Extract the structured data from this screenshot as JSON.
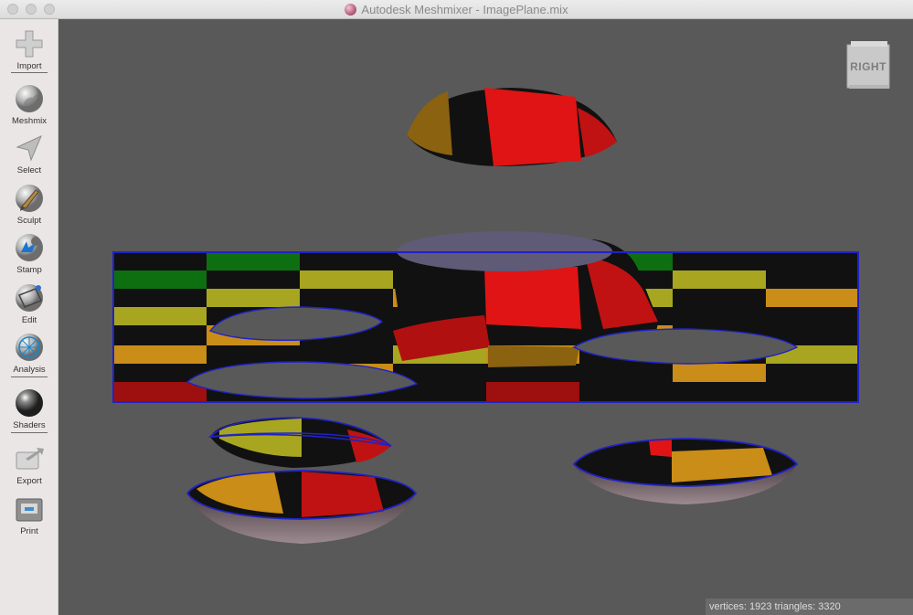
{
  "window": {
    "title": "Autodesk Meshmixer - ImagePlane.mix"
  },
  "toolbar": {
    "items": [
      {
        "label": "Import",
        "icon": "plus-icon"
      },
      {
        "label": "Meshmix",
        "icon": "meshmix-bunny-icon"
      },
      {
        "label": "Select",
        "icon": "select-arrow-icon"
      },
      {
        "label": "Sculpt",
        "icon": "sculpt-brush-icon"
      },
      {
        "label": "Stamp",
        "icon": "stamp-icon"
      },
      {
        "label": "Edit",
        "icon": "edit-icon"
      },
      {
        "label": "Analysis",
        "icon": "analysis-mesh-icon"
      },
      {
        "label": "Shaders",
        "icon": "shader-sphere-icon"
      },
      {
        "label": "Export",
        "icon": "export-icon"
      },
      {
        "label": "Print",
        "icon": "printer-icon"
      }
    ]
  },
  "viewcube": {
    "label": "RIGHT"
  },
  "status": {
    "text": "vertices: 1923 triangles: 3320"
  },
  "colors": {
    "viewport_bg": "#595959",
    "checker_red": "#e01414",
    "checker_green": "#0e6f10",
    "checker_yellow": "#a8a620",
    "checker_orange": "#c98d18",
    "checker_black": "#111111",
    "selection_outline": "#1f22c8"
  }
}
